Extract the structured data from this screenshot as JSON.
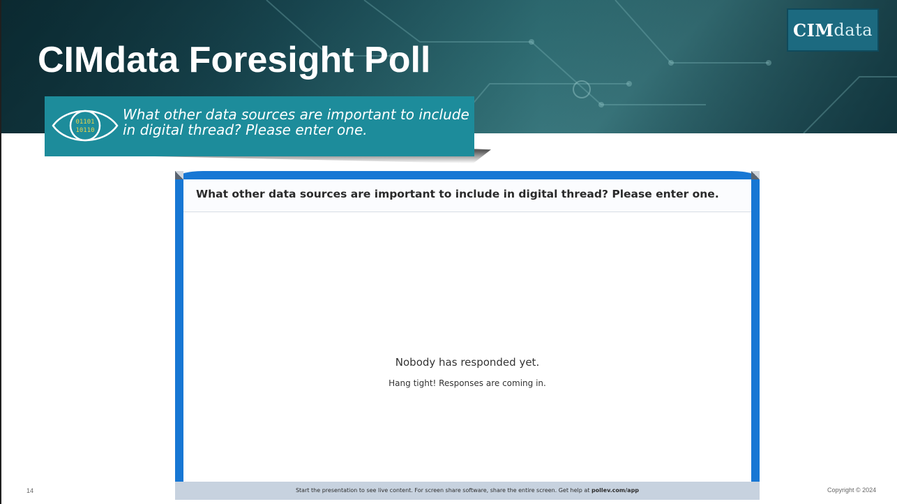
{
  "slide": {
    "title": "CIMdata Foresight Poll",
    "logo": {
      "strong": "CIM",
      "thin": "data"
    },
    "callout_question": "What other data sources are important to include in digital thread? Please enter one.",
    "eye_binary_line1": "01101",
    "eye_binary_line2": "10110",
    "slide_number": "14",
    "copyright": "Copyright © 2024"
  },
  "poll": {
    "question": "What other data sources are important to include in digital thread? Please enter one.",
    "empty_message": "Nobody has responded yet.",
    "empty_submessage": "Hang tight! Responses are coming in.",
    "footer_text": "Start the presentation to see live content. For screen share software, share the entire screen. Get help at ",
    "footer_link": "pollev.com/app"
  },
  "colors": {
    "callout_bg": "#1d8c9b",
    "poll_frame": "#1777d4",
    "logo_bg": "#1c6a80"
  }
}
